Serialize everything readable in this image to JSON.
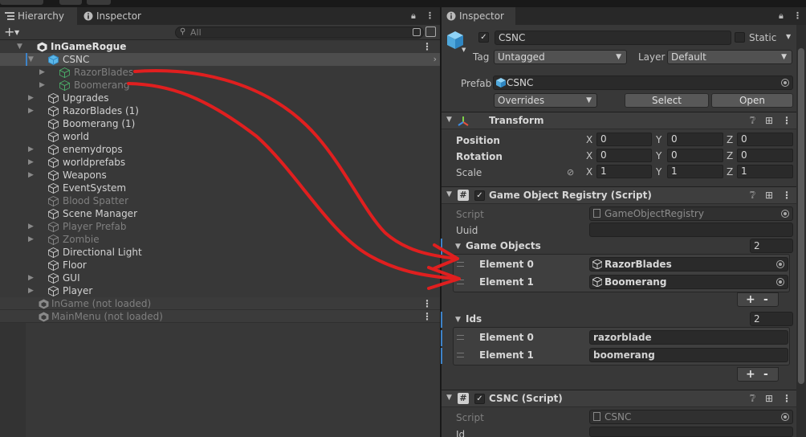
{
  "hierarchy": {
    "tabs": [
      {
        "label": "Hierarchy"
      },
      {
        "label": "Inspector"
      }
    ],
    "search_placeholder": "All",
    "add_label": "+",
    "items": [
      {
        "label": "InGameRogue",
        "level": 0,
        "expanded": true,
        "scene": true
      },
      {
        "label": "CSNC",
        "level": 1,
        "expanded": true,
        "selected": true
      },
      {
        "label": "RazorBlades",
        "level": 2,
        "dim": true,
        "prefab_green": true
      },
      {
        "label": "Boomerang",
        "level": 2,
        "dim": true,
        "prefab_green": true
      },
      {
        "label": "Upgrades",
        "level": 1
      },
      {
        "label": "RazorBlades (1)",
        "level": 1
      },
      {
        "label": "Boomerang (1)",
        "level": 1
      },
      {
        "label": "world",
        "level": 1
      },
      {
        "label": "enemydrops",
        "level": 1
      },
      {
        "label": "worldprefabs",
        "level": 1
      },
      {
        "label": "Weapons",
        "level": 1
      },
      {
        "label": "EventSystem",
        "level": 1
      },
      {
        "label": "Blood Spatter",
        "level": 1,
        "dim": true
      },
      {
        "label": "Scene Manager",
        "level": 1
      },
      {
        "label": "Player Prefab",
        "level": 1,
        "dim": true
      },
      {
        "label": "Zombie",
        "level": 1,
        "dim": true
      },
      {
        "label": "Directional Light",
        "level": 1
      },
      {
        "label": "Floor",
        "level": 1
      },
      {
        "label": "GUI",
        "level": 1
      },
      {
        "label": "Player",
        "level": 1
      }
    ],
    "unloaded_scenes": [
      {
        "label": "InGame (not loaded)"
      },
      {
        "label": "MainMenu (not loaded)"
      }
    ]
  },
  "inspector": {
    "tab_label": "Inspector",
    "object_name": "CSNC",
    "static_label": "Static",
    "tag_label": "Tag",
    "tag_value": "Untagged",
    "layer_label": "Layer",
    "layer_value": "Default",
    "prefab_label": "Prefab",
    "prefab_value": "CSNC",
    "overrides_label": "Overrides",
    "select_label": "Select",
    "open_label": "Open",
    "transform": {
      "title": "Transform",
      "position_label": "Position",
      "rotation_label": "Rotation",
      "scale_label": "Scale",
      "position": [
        "0",
        "0",
        "0"
      ],
      "rotation": [
        "0",
        "0",
        "0"
      ],
      "scale": [
        "1",
        "1",
        "1"
      ],
      "axis_labels": [
        "X",
        "Y",
        "Z"
      ]
    },
    "registry": {
      "title": "Game Object Registry (Script)",
      "script_label": "Script",
      "script_value": "GameObjectRegistry",
      "uuid_label": "Uuid",
      "uuid_value": "",
      "game_objects_label": "Game Objects",
      "game_objects_count": "2",
      "game_objects": [
        {
          "label": "Element 0",
          "value": "RazorBlades"
        },
        {
          "label": "Element 1",
          "value": "Boomerang"
        }
      ],
      "ids_label": "Ids",
      "ids_count": "2",
      "ids": [
        {
          "label": "Element 0",
          "value": "razorblade"
        },
        {
          "label": "Element 1",
          "value": "boomerang"
        }
      ],
      "plus": "+",
      "minus": "-"
    },
    "csnc_script": {
      "title": "CSNC (Script)",
      "script_label": "Script",
      "script_value": "CSNC",
      "id_label": "Id"
    }
  },
  "colors": {
    "annotation_red": "#e01f1f",
    "selection_blue": "#3d83c9",
    "prefab_cube": "#5cb7e8"
  }
}
